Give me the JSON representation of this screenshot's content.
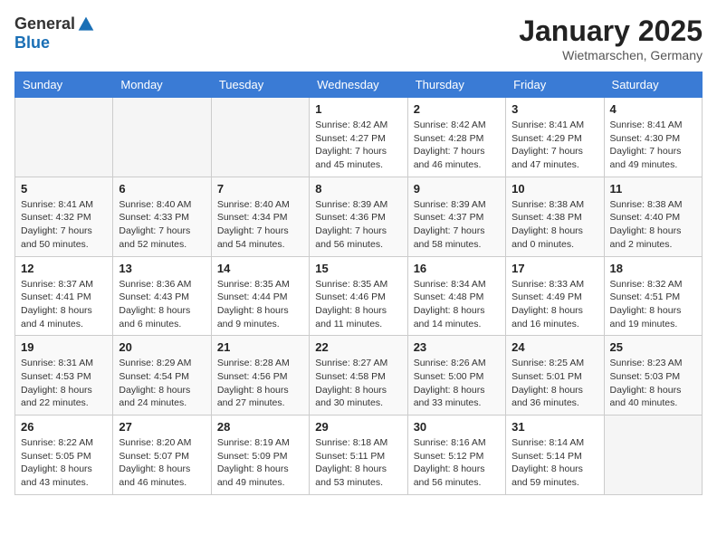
{
  "header": {
    "logo_general": "General",
    "logo_blue": "Blue",
    "month": "January 2025",
    "location": "Wietmarschen, Germany"
  },
  "days_of_week": [
    "Sunday",
    "Monday",
    "Tuesday",
    "Wednesday",
    "Thursday",
    "Friday",
    "Saturday"
  ],
  "weeks": [
    [
      {
        "num": "",
        "info": ""
      },
      {
        "num": "",
        "info": ""
      },
      {
        "num": "",
        "info": ""
      },
      {
        "num": "1",
        "info": "Sunrise: 8:42 AM\nSunset: 4:27 PM\nDaylight: 7 hours and 45 minutes."
      },
      {
        "num": "2",
        "info": "Sunrise: 8:42 AM\nSunset: 4:28 PM\nDaylight: 7 hours and 46 minutes."
      },
      {
        "num": "3",
        "info": "Sunrise: 8:41 AM\nSunset: 4:29 PM\nDaylight: 7 hours and 47 minutes."
      },
      {
        "num": "4",
        "info": "Sunrise: 8:41 AM\nSunset: 4:30 PM\nDaylight: 7 hours and 49 minutes."
      }
    ],
    [
      {
        "num": "5",
        "info": "Sunrise: 8:41 AM\nSunset: 4:32 PM\nDaylight: 7 hours and 50 minutes."
      },
      {
        "num": "6",
        "info": "Sunrise: 8:40 AM\nSunset: 4:33 PM\nDaylight: 7 hours and 52 minutes."
      },
      {
        "num": "7",
        "info": "Sunrise: 8:40 AM\nSunset: 4:34 PM\nDaylight: 7 hours and 54 minutes."
      },
      {
        "num": "8",
        "info": "Sunrise: 8:39 AM\nSunset: 4:36 PM\nDaylight: 7 hours and 56 minutes."
      },
      {
        "num": "9",
        "info": "Sunrise: 8:39 AM\nSunset: 4:37 PM\nDaylight: 7 hours and 58 minutes."
      },
      {
        "num": "10",
        "info": "Sunrise: 8:38 AM\nSunset: 4:38 PM\nDaylight: 8 hours and 0 minutes."
      },
      {
        "num": "11",
        "info": "Sunrise: 8:38 AM\nSunset: 4:40 PM\nDaylight: 8 hours and 2 minutes."
      }
    ],
    [
      {
        "num": "12",
        "info": "Sunrise: 8:37 AM\nSunset: 4:41 PM\nDaylight: 8 hours and 4 minutes."
      },
      {
        "num": "13",
        "info": "Sunrise: 8:36 AM\nSunset: 4:43 PM\nDaylight: 8 hours and 6 minutes."
      },
      {
        "num": "14",
        "info": "Sunrise: 8:35 AM\nSunset: 4:44 PM\nDaylight: 8 hours and 9 minutes."
      },
      {
        "num": "15",
        "info": "Sunrise: 8:35 AM\nSunset: 4:46 PM\nDaylight: 8 hours and 11 minutes."
      },
      {
        "num": "16",
        "info": "Sunrise: 8:34 AM\nSunset: 4:48 PM\nDaylight: 8 hours and 14 minutes."
      },
      {
        "num": "17",
        "info": "Sunrise: 8:33 AM\nSunset: 4:49 PM\nDaylight: 8 hours and 16 minutes."
      },
      {
        "num": "18",
        "info": "Sunrise: 8:32 AM\nSunset: 4:51 PM\nDaylight: 8 hours and 19 minutes."
      }
    ],
    [
      {
        "num": "19",
        "info": "Sunrise: 8:31 AM\nSunset: 4:53 PM\nDaylight: 8 hours and 22 minutes."
      },
      {
        "num": "20",
        "info": "Sunrise: 8:29 AM\nSunset: 4:54 PM\nDaylight: 8 hours and 24 minutes."
      },
      {
        "num": "21",
        "info": "Sunrise: 8:28 AM\nSunset: 4:56 PM\nDaylight: 8 hours and 27 minutes."
      },
      {
        "num": "22",
        "info": "Sunrise: 8:27 AM\nSunset: 4:58 PM\nDaylight: 8 hours and 30 minutes."
      },
      {
        "num": "23",
        "info": "Sunrise: 8:26 AM\nSunset: 5:00 PM\nDaylight: 8 hours and 33 minutes."
      },
      {
        "num": "24",
        "info": "Sunrise: 8:25 AM\nSunset: 5:01 PM\nDaylight: 8 hours and 36 minutes."
      },
      {
        "num": "25",
        "info": "Sunrise: 8:23 AM\nSunset: 5:03 PM\nDaylight: 8 hours and 40 minutes."
      }
    ],
    [
      {
        "num": "26",
        "info": "Sunrise: 8:22 AM\nSunset: 5:05 PM\nDaylight: 8 hours and 43 minutes."
      },
      {
        "num": "27",
        "info": "Sunrise: 8:20 AM\nSunset: 5:07 PM\nDaylight: 8 hours and 46 minutes."
      },
      {
        "num": "28",
        "info": "Sunrise: 8:19 AM\nSunset: 5:09 PM\nDaylight: 8 hours and 49 minutes."
      },
      {
        "num": "29",
        "info": "Sunrise: 8:18 AM\nSunset: 5:11 PM\nDaylight: 8 hours and 53 minutes."
      },
      {
        "num": "30",
        "info": "Sunrise: 8:16 AM\nSunset: 5:12 PM\nDaylight: 8 hours and 56 minutes."
      },
      {
        "num": "31",
        "info": "Sunrise: 8:14 AM\nSunset: 5:14 PM\nDaylight: 8 hours and 59 minutes."
      },
      {
        "num": "",
        "info": ""
      }
    ]
  ]
}
